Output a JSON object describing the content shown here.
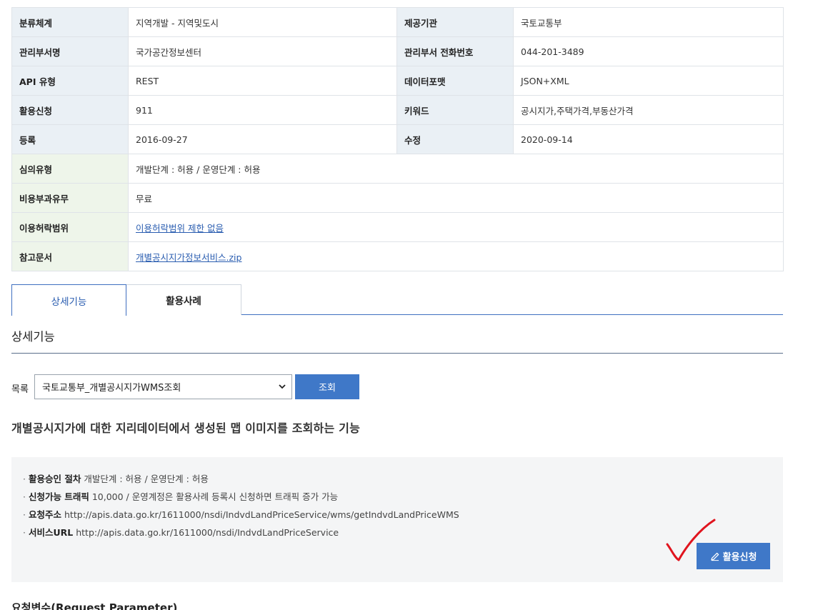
{
  "info_table": {
    "rows": [
      {
        "k1": "분류체계",
        "v1": "지역개발 - 지역및도시",
        "k2": "제공기관",
        "v2": "국토교통부"
      },
      {
        "k1": "관리부서명",
        "v1": "국가공간정보센터",
        "k2": "관리부서 전화번호",
        "v2": "044-201-3489"
      },
      {
        "k1": "API 유형",
        "v1": "REST",
        "k2": "데이터포맷",
        "v2": "JSON+XML"
      },
      {
        "k1": "활용신청",
        "v1": "911",
        "k2": "키워드",
        "v2": "공시지가,주택가격,부동산가격"
      },
      {
        "k1": "등록",
        "v1": "2016-09-27",
        "k2": "수정",
        "v2": "2020-09-14"
      }
    ],
    "wide_rows": [
      {
        "k": "심의유형",
        "v": "개발단계 : 허용 / 운영단계 : 허용"
      },
      {
        "k": "비용부과유무",
        "v": "무료"
      },
      {
        "k": "이용허락범위",
        "v": "이용허락범위 제한 없음"
      },
      {
        "k": "참고문서",
        "v": "개별공시지가정보서비스.zip"
      }
    ]
  },
  "tabs": {
    "detail": "상세기능",
    "cases": "활용사례"
  },
  "section": {
    "title": "상세기능"
  },
  "list": {
    "label": "목록",
    "selected": "국토교통부_개별공시지가WMS조회",
    "search_label": "조회"
  },
  "description": "개별공시지가에 대한 지리데이터에서 생성된 맵 이미지를 조회하는 기능",
  "details": {
    "dot": "·",
    "procedure_label": "활용승인 절차",
    "procedure_value": "개발단계 : 허용 / 운영단계 : 허용",
    "traffic_label": "신청가능 트래픽",
    "traffic_value": "10,000 / 운영계정은 활용사례 등록시 신청하면 트래픽 증가 가능",
    "endpoint_label": "요청주소",
    "endpoint_value": "http://apis.data.go.kr/1611000/nsdi/IndvdLandPriceService/wms/getIndvdLandPriceWMS",
    "service_label": "서비스URL",
    "service_value": "http://apis.data.go.kr/1611000/nsdi/IndvdLandPriceService"
  },
  "apply_button": {
    "label": "활용신청"
  },
  "next_section": {
    "title": "요청변수(Request Parameter)"
  },
  "colors": {
    "accent": "#3f78c8",
    "link": "#2a5db0",
    "annotation": "#e0141e"
  }
}
